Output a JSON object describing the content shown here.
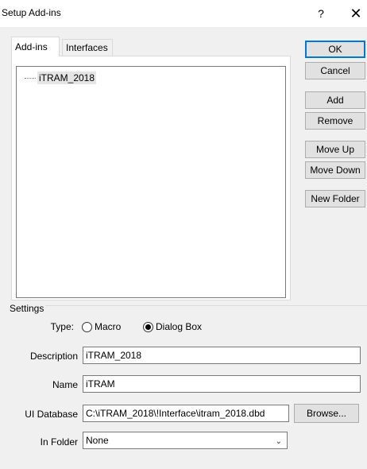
{
  "window": {
    "title": "Setup Add-ins",
    "help_label": "?",
    "close_label": "✕"
  },
  "tabs": [
    {
      "label": "Add-ins",
      "active": true
    },
    {
      "label": "Interfaces",
      "active": false
    }
  ],
  "tree": {
    "items": [
      {
        "label": "iTRAM_2018"
      }
    ]
  },
  "buttons": {
    "ok": "OK",
    "cancel": "Cancel",
    "add": "Add",
    "remove": "Remove",
    "move_up": "Move Up",
    "move_down": "Move Down",
    "new_folder": "New Folder",
    "browse": "Browse..."
  },
  "settings": {
    "group_label": "Settings",
    "type_label": "Type:",
    "type_options": [
      {
        "label": "Macro",
        "selected": false
      },
      {
        "label": "Dialog Box",
        "selected": true
      }
    ],
    "description_label": "Description",
    "description_value": "iTRAM_2018",
    "name_label": "Name",
    "name_value": "iTRAM",
    "ui_database_label": "UI Database",
    "ui_database_value": "C:\\iTRAM_2018\\!Interface\\itram_2018.dbd",
    "in_folder_label": "In Folder",
    "in_folder_value": "None"
  },
  "colors": {
    "accent": "#0078d7",
    "window_bg": "#f0f0f0"
  }
}
